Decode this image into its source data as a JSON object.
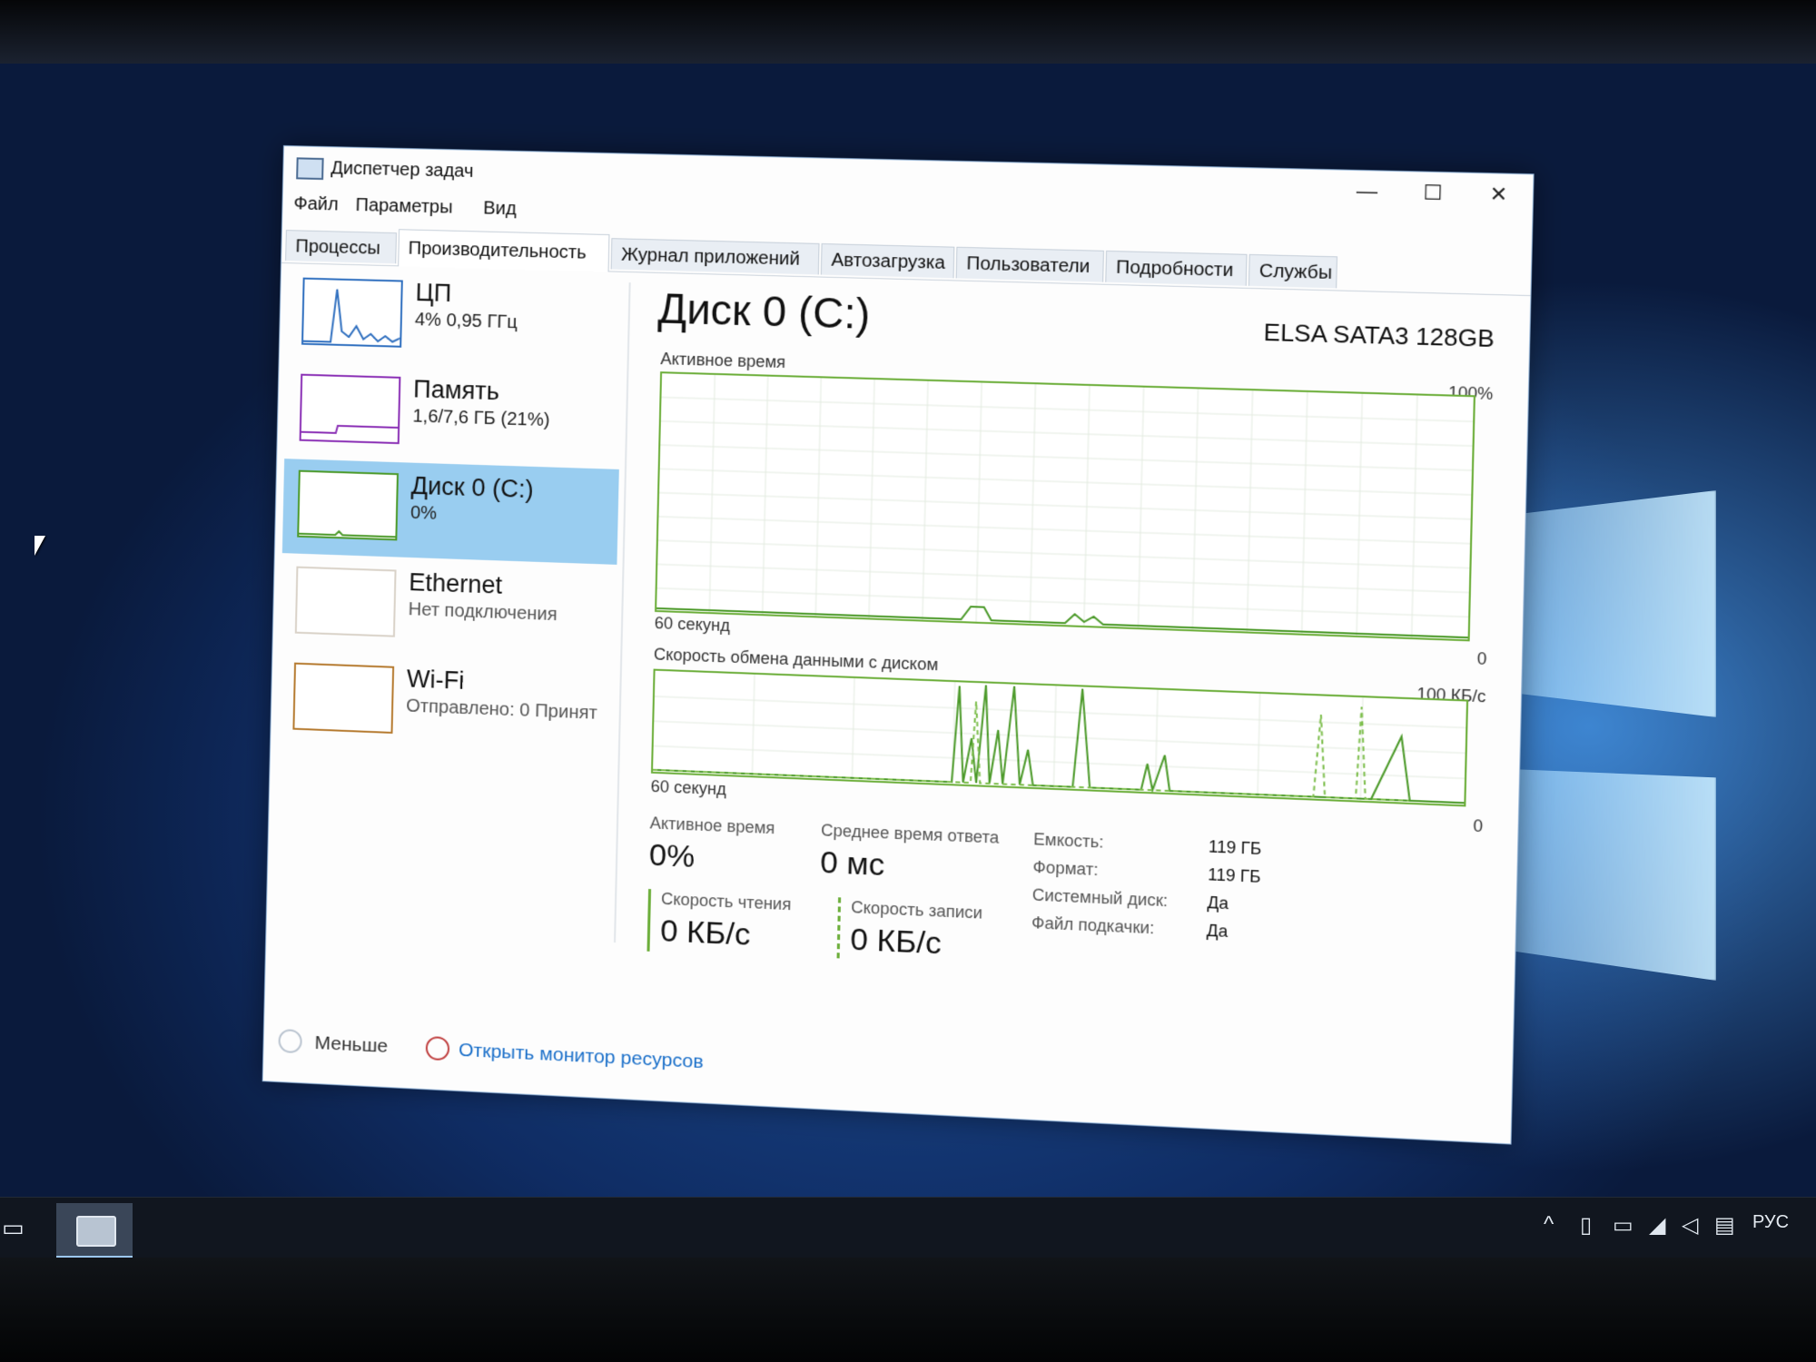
{
  "window": {
    "title": "Диспетчер задач",
    "controls": {
      "minimize": "—",
      "maximize": "☐",
      "close": "✕"
    }
  },
  "menu": [
    "Файл",
    "Параметры",
    "Вид"
  ],
  "tabs": [
    "Процессы",
    "Производительность",
    "Журнал приложений",
    "Автозагрузка",
    "Пользователи",
    "Подробности",
    "Службы"
  ],
  "active_tab": "Производительность",
  "sidebar": [
    {
      "name": "ЦП",
      "sub": "4% 0,95 ГГц",
      "color": "#2f6fbf"
    },
    {
      "name": "Память",
      "sub": "1,6/7,6 ГБ (21%)",
      "color": "#8a2fb5"
    },
    {
      "name": "Диск 0 (C:)",
      "sub": "0%",
      "color": "#4c9a2a"
    },
    {
      "name": "Ethernet",
      "sub": "Нет подключения",
      "color": "#b57a2f"
    },
    {
      "name": "Wi-Fi",
      "sub": "Отправлено: 0 Принят",
      "color": "#b57a2f"
    }
  ],
  "main": {
    "title": "Диск 0 (C:)",
    "device": "ELSA  SATA3 128GB",
    "graph1": {
      "label": "Активное время",
      "max": "100%",
      "time": "60 секунд",
      "zero": "0"
    },
    "graph2": {
      "label": "Скорость обмена данными с диском",
      "max": "100 КБ/с",
      "time": "60 секунд",
      "zero": "0"
    },
    "stats": {
      "active_time_label": "Активное время",
      "active_time_value": "0%",
      "avg_response_label": "Среднее время ответа",
      "avg_response_value": "0 мс",
      "read_label": "Скорость чтения",
      "read_value": "0 КБ/с",
      "write_label": "Скорость записи",
      "write_value": "0 КБ/с"
    },
    "details": [
      {
        "key": "Емкость:",
        "value": "119 ГБ"
      },
      {
        "key": "Формат:",
        "value": "119 ГБ"
      },
      {
        "key": "Системный диск:",
        "value": "Да"
      },
      {
        "key": "Файл подкачки:",
        "value": "Да"
      }
    ]
  },
  "footer": {
    "less": "Меньше",
    "monitor": "Открыть монитор ресурсов"
  },
  "taskbar": {
    "lang": "РУС"
  },
  "colors": {
    "accent_green": "#6cae3a",
    "selected_bg": "#99cdf0",
    "link_blue": "#1a6fc9"
  }
}
